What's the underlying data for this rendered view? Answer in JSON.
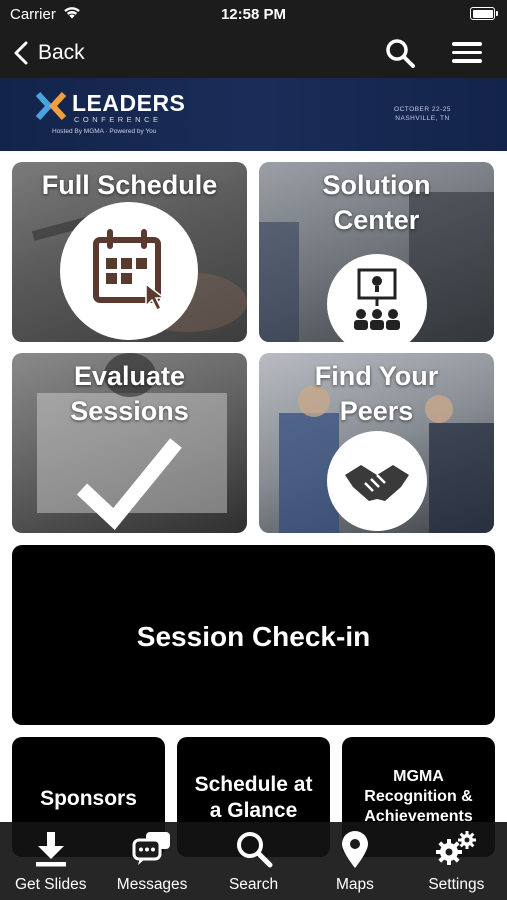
{
  "status_bar": {
    "carrier": "Carrier",
    "time": "12:58 PM"
  },
  "nav": {
    "back_label": "Back"
  },
  "banner": {
    "title": "LEADERS",
    "subtitle": "CONFERENCE",
    "hosted": "Hosted By MGMA · Powered by You",
    "date": "OCTOBER 22-25",
    "location": "NASHVILLE, TN"
  },
  "tiles": {
    "full_schedule": "Full Schedule",
    "solution_center_1": "Solution",
    "solution_center_2": "Center",
    "evaluate_1": "Evaluate",
    "evaluate_2": "Sessions",
    "peers_1": "Find Your",
    "peers_2": "Peers",
    "checkin": "Session Check-in",
    "sponsors": "Sponsors",
    "glance_1": "Schedule at",
    "glance_2": "a Glance",
    "mgma_1": "MGMA",
    "mgma_2": "Recognition &",
    "mgma_3": "Achievements"
  },
  "tab_bar": {
    "items": [
      {
        "label": "Get Slides",
        "icon": "download-icon"
      },
      {
        "label": "Messages",
        "icon": "messages-icon"
      },
      {
        "label": "Search",
        "icon": "search-icon"
      },
      {
        "label": "Maps",
        "icon": "map-pin-icon"
      },
      {
        "label": "Settings",
        "icon": "gears-icon"
      }
    ]
  },
  "colors": {
    "bar": "#1c1c1c",
    "banner": "#1a2d58",
    "accent_orange": "#f0a03a",
    "accent_blue": "#4aa3df"
  }
}
